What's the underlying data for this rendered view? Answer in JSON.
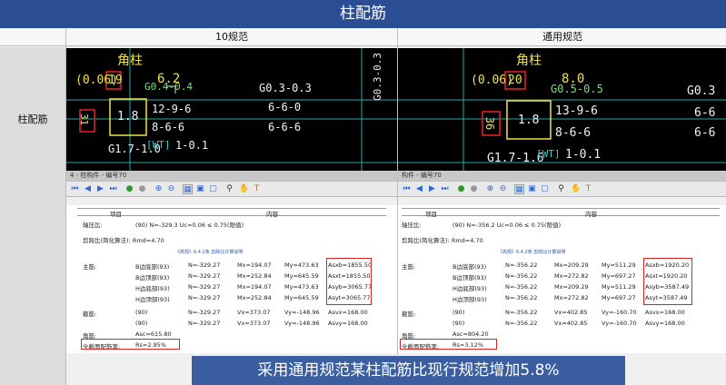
{
  "title": "柱配筋",
  "headers": {
    "col1": "10规范",
    "col2": "通用规范"
  },
  "row_label": "柱配筋",
  "caption": "采用通用规范某柱配筋比现行规范增加5.8%",
  "left": {
    "corner_label": "角柱",
    "ratio": "(0.06)",
    "ratio_box": "19",
    "top_val": "6.2",
    "g_top": "G0.4-0.4",
    "side_box": "31",
    "center_val": "1.8",
    "line1": "12-9-6",
    "line2": "8-6-6",
    "bottom": "G1.7-1.0",
    "wt": "[WT]",
    "bottom_r": "1-0.1",
    "col2_g": "G0.3-0.3",
    "col2_l1": "6-6-0",
    "col2_l2": "6-6-6",
    "vert_g": "G0.3-0.3",
    "window_title": "4 - 柱构件 - 编号70"
  },
  "right": {
    "corner_label": "角柱",
    "ratio": "(0.06)",
    "ratio_box": "20",
    "top_val": "8.0",
    "g_top": "G0.5-0.5",
    "side_box": "36",
    "center_val": "1.8",
    "line1": "13-9-6",
    "line2": "8-6-6",
    "bottom": "G1.7-1.6",
    "wt": "[WT]",
    "bottom_r": "1-0.1",
    "col2_g": "G0.3",
    "col2_l1": "6-6",
    "col2_l2": "6-6",
    "window_title": "构件 - 编号70"
  },
  "report_left": {
    "h1": "项目",
    "h2": "内容",
    "axial": "轴压比:",
    "axial_v": "(90)  N=-329.3   Uc=0.06 ≤ 0.75(限值)",
    "shear": "剪跨比(简化算法): Rmd=4.70",
    "note": "《高规》6.4.2条 剪跨比计算说明",
    "main": "主筋:",
    "rows": [
      [
        "B边底部(93)",
        "N=-329.27",
        "Mx=194.07",
        "My=473.63",
        "Asxb=1855.50"
      ],
      [
        "B边顶部(93)",
        "N=-329.27",
        "Mx=252.84",
        "My=645.59",
        "Asxt=1855.50"
      ],
      [
        "H边底部(93)",
        "N=-329.27",
        "Mx=194.07",
        "My=473.63",
        "Asyb=3065.77"
      ],
      [
        "H边顶部(93)",
        "N=-329.27",
        "Mx=252.84",
        "My=645.59",
        "Asyt=3065.77"
      ]
    ],
    "stirrup": "箍筋:",
    "srows": [
      [
        "(90)",
        "N=-329.27",
        "Vx=373.07",
        "Vy=-148.96",
        "Asvx=168.00"
      ],
      [
        "(90)",
        "N=-329.27",
        "Vx=373.07",
        "Vy=-148.96",
        "Asvy=168.00"
      ]
    ],
    "corner": "角筋:",
    "corner_v": "Asc=615.80",
    "full": "全截面配筋率:",
    "full_v": "Rs=2.95%"
  },
  "report_right": {
    "h1": "项目",
    "h2": "内容",
    "axial": "轴压比:",
    "axial_v": "(90)  N=-356.2   Uc=0.06 ≤ 0.75(限值)",
    "shear": "剪跨比(简化算法): Rmd=4.70",
    "note": "《高规》6.4.2条 剪跨比计算说明",
    "main": "主筋:",
    "rows": [
      [
        "B边底部(93)",
        "N=-356.22",
        "Mx=209.29",
        "My=511.29",
        "Asxb=1920.20"
      ],
      [
        "B边顶部(93)",
        "N=-356.22",
        "Mx=272.82",
        "My=697.27",
        "Asxt=1920.20"
      ],
      [
        "H边底部(93)",
        "N=-356.22",
        "Mx=209.29",
        "My=511.29",
        "Asyb=3587.49"
      ],
      [
        "H边顶部(93)",
        "N=-356.22",
        "Mx=272.82",
        "My=697.27",
        "Asyt=3587.49"
      ]
    ],
    "stirrup": "箍筋:",
    "srows": [
      [
        "(90)",
        "N=-356.22",
        "Vx=402.85",
        "Vy=-160.70",
        "Asvx=168.00"
      ],
      [
        "(90)",
        "N=-356.22",
        "Vx=402.85",
        "Vy=-160.70",
        "Asvy=168.00"
      ]
    ],
    "corner": "角筋:",
    "corner_v": "Asc=804.20",
    "full": "全截面配筋率:",
    "full_v": "Rs=3.12%"
  }
}
